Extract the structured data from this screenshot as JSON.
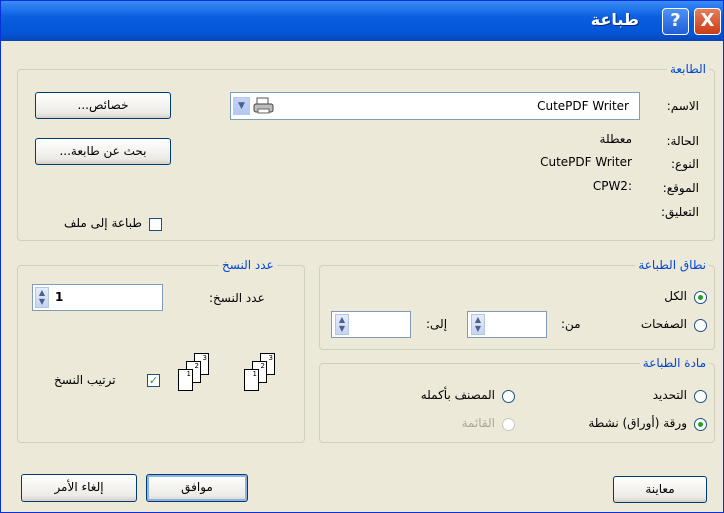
{
  "window": {
    "title": "طباعة",
    "help": "?",
    "close": "X"
  },
  "printer": {
    "legend": "الطابعة",
    "name_label": "الاسم:",
    "name_value": "CutePDF Writer",
    "status_label": "الحالة:",
    "status_value": "معطلة",
    "type_label": "النوع:",
    "type_value": "CutePDF Writer",
    "where_label": "الموقع:",
    "where_value": "CPW2:",
    "comment_label": "التعليق:",
    "properties_button": "خصائص...",
    "find_printer_button": "بحث عن طابعة...",
    "print_to_file_label": "طباعة إلى ملف",
    "print_to_file_checked": false
  },
  "range": {
    "legend": "نطاق الطباعة",
    "all_label": "الكل",
    "pages_label": "الصفحات",
    "from_label": "من:",
    "to_label": "إلى:",
    "from_value": "",
    "to_value": "",
    "selected": "all"
  },
  "copies": {
    "legend": "عدد النسخ",
    "count_label": "عدد النسخ:",
    "count_value": "1",
    "collate_label": "ترتيب النسخ",
    "collate_checked": true,
    "page_numbers": [
      "1",
      "2",
      "3"
    ]
  },
  "print_what": {
    "legend": "مادة الطباعة",
    "selection_label": "التحديد",
    "whole_workbook_label": "المصنف بأكمله",
    "active_sheets_label": "ورقة (أوراق) نشطة",
    "table_label": "القائمة",
    "selected": "active_sheets"
  },
  "buttons": {
    "preview": "معاينة",
    "ok": "موافق",
    "cancel": "إلغاء الأمر"
  }
}
